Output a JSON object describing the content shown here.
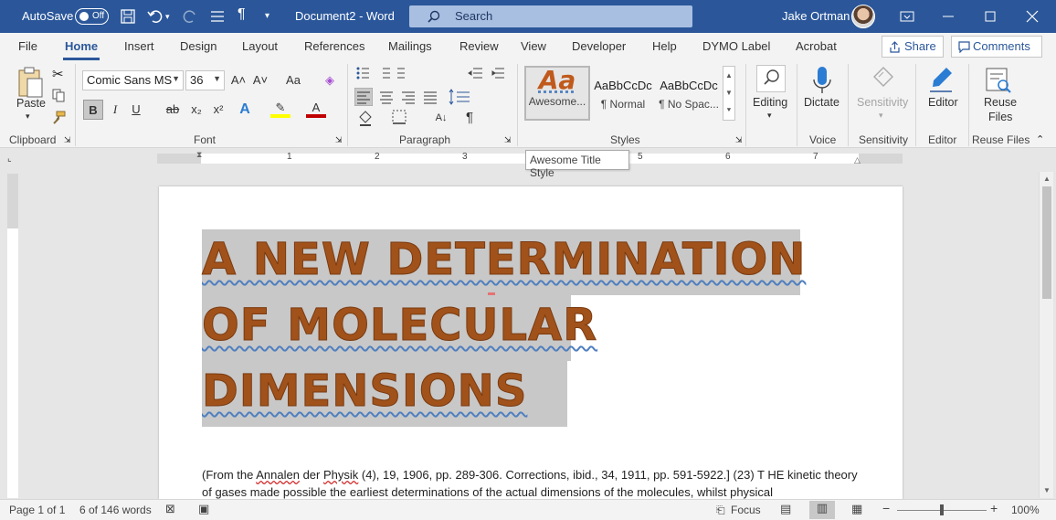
{
  "titlebar": {
    "autosave_label": "AutoSave",
    "autosave_state": "Off",
    "document_title": "Document2  -  Word",
    "search_placeholder": "Search",
    "user_name": "Jake Ortman"
  },
  "tabs": [
    "File",
    "Home",
    "Insert",
    "Design",
    "Layout",
    "References",
    "Mailings",
    "Review",
    "View",
    "Developer",
    "Help",
    "DYMO Label",
    "Acrobat"
  ],
  "active_tab": "Home",
  "share_label": "Share",
  "comments_label": "Comments",
  "ribbon": {
    "clipboard": {
      "paste_label": "Paste",
      "group_label": "Clipboard"
    },
    "font": {
      "font_name": "Comic Sans MS",
      "font_size": "36",
      "group_label": "Font",
      "bold": "B",
      "italic": "I",
      "underline": "U",
      "strike": "ab",
      "subscript": "x₂",
      "superscript": "x²",
      "grow": "A˄",
      "shrink": "A˅",
      "case": "Aa"
    },
    "paragraph": {
      "group_label": "Paragraph"
    },
    "styles": {
      "group_label": "Styles",
      "items": [
        {
          "preview": "Aa",
          "name": "Awesome..."
        },
        {
          "preview": "AaBbCcDc",
          "name": "¶ Normal"
        },
        {
          "preview": "AaBbCcDc",
          "name": "¶ No Spac..."
        }
      ]
    },
    "editing_label": "Editing",
    "voice": {
      "dictate_label": "Dictate",
      "group_label": "Voice"
    },
    "sensitivity": {
      "label": "Sensitivity",
      "group_label": "Sensitivity"
    },
    "editor": {
      "label": "Editor",
      "group_label": "Editor"
    },
    "reuse": {
      "label_line1": "Reuse",
      "label_line2": "Files",
      "group_label": "Reuse Files"
    }
  },
  "tooltip": "Awesome Title Style",
  "ruler_numbers": [
    "1",
    "2",
    "3",
    "5",
    "6",
    "7"
  ],
  "document": {
    "title_lines": [
      "A NEW DETERMINATION",
      "OF MOLECULAR",
      "DIMENSIONS"
    ],
    "body_part1": "(From the ",
    "body_annalen": "Annalen",
    "body_part2": " der ",
    "body_physik": "Physik",
    "body_part3": " (4), 19, 1906, pp. 289-306. Corrections, ibid., 34, 1911, pp. 591-5922.] (23) T HE kinetic theory of gases made possible the earliest determinations of the actual dimensions of the molecules, whilst physical"
  },
  "status": {
    "page": "Page 1 of 1",
    "words": "6 of 146 words",
    "focus": "Focus",
    "zoom": "100%"
  },
  "colors": {
    "title_bar": "#2b579a",
    "title_text": "#a0521a",
    "selection": "#c8c8c8"
  }
}
